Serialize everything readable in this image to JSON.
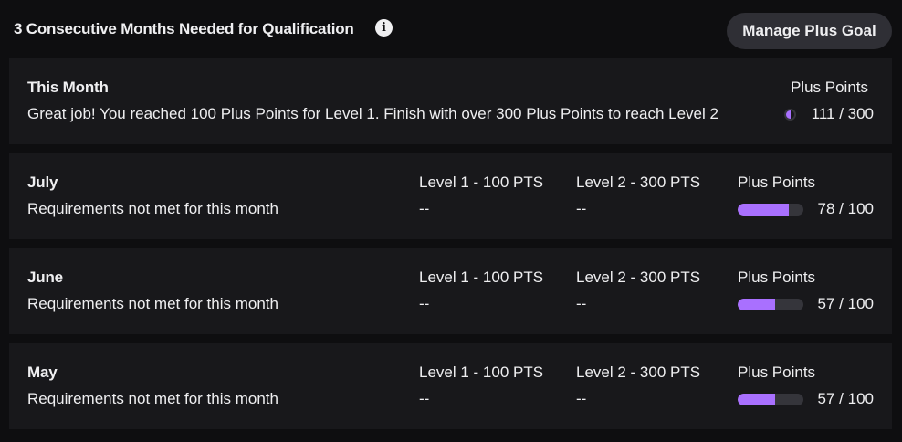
{
  "header": {
    "title": "3 Consecutive Months Needed for Qualification",
    "info_glyph": "i",
    "manage_button": "Manage Plus Goal"
  },
  "this_month": {
    "name": "This Month",
    "message": "Great job! You reached 100 Plus Points for Level 1. Finish with over 300 Plus Points to reach Level 2",
    "points_label": "Plus Points",
    "points": "111 / 300",
    "progress": 0.37
  },
  "months": [
    {
      "name": "July",
      "status": "Requirements not met for this month",
      "level1_label": "Level 1 - 100 PTS",
      "level1_value": "--",
      "level2_label": "Level 2 - 300 PTS",
      "level2_value": "--",
      "points_label": "Plus Points",
      "points": "78 / 100",
      "progress": 0.78
    },
    {
      "name": "June",
      "status": "Requirements not met for this month",
      "level1_label": "Level 1 - 100 PTS",
      "level1_value": "--",
      "level2_label": "Level 2 - 300 PTS",
      "level2_value": "--",
      "points_label": "Plus Points",
      "points": "57 / 100",
      "progress": 0.57
    },
    {
      "name": "May",
      "status": "Requirements not met for this month",
      "level1_label": "Level 1 - 100 PTS",
      "level1_value": "--",
      "level2_label": "Level 2 - 300 PTS",
      "level2_value": "--",
      "points_label": "Plus Points",
      "points": "57 / 100",
      "progress": 0.57
    }
  ],
  "colors": {
    "accent": "#a970ff",
    "card_bg": "#18181b",
    "page_bg": "#0e0e10",
    "track": "#35353b"
  }
}
